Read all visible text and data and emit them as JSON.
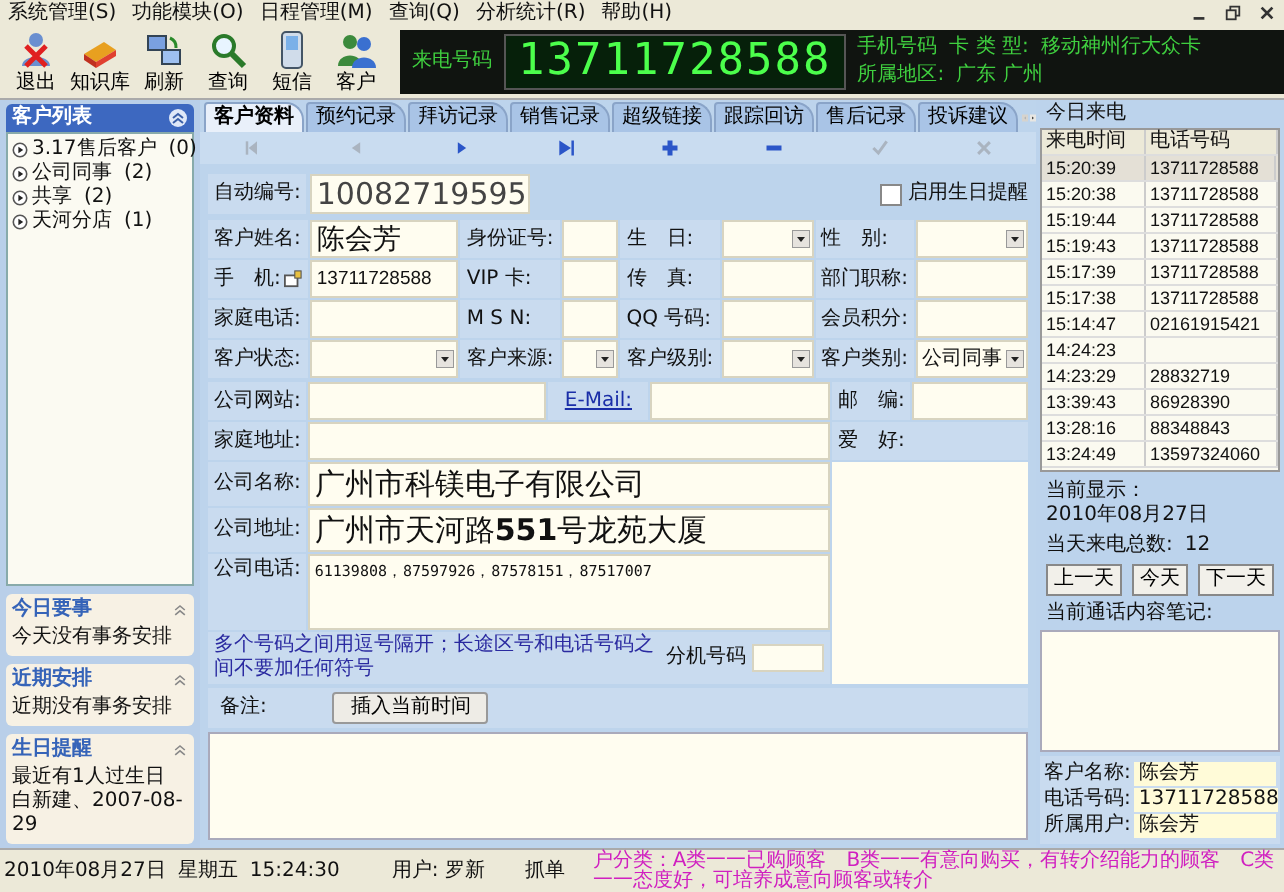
{
  "menu": [
    "系统管理(S)",
    "功能模块(O)",
    "日程管理(M)",
    "查询(Q)",
    "分析统计(R)",
    "帮助(H)"
  ],
  "toolbar": [
    {
      "kind": "exit",
      "label": "退出"
    },
    {
      "kind": "knowledge",
      "label": "知识库"
    },
    {
      "kind": "refresh",
      "label": "刷新"
    },
    {
      "kind": "query",
      "label": "查询"
    },
    {
      "kind": "sms",
      "label": "短信"
    },
    {
      "kind": "customer",
      "label": "客户"
    }
  ],
  "caller_display": {
    "label": "来电号码",
    "number": "13711728588",
    "lines": [
      [
        "手机号码",
        "卡 类 型:",
        "移动神州行大众卡"
      ],
      [
        "所属地区:",
        "广东 广州"
      ]
    ]
  },
  "sidebar": {
    "title": "客户列表",
    "items": [
      {
        "name": "3.17售后客户",
        "count": "(0)"
      },
      {
        "name": "公司同事",
        "count": "(2)"
      },
      {
        "name": "共享",
        "count": "(2)"
      },
      {
        "name": "天河分店",
        "count": "(1)"
      }
    ],
    "panels": [
      {
        "title": "今日要事",
        "lines": [
          "今天没有事务安排"
        ]
      },
      {
        "title": "近期安排",
        "lines": [
          "近期没有事务安排"
        ]
      },
      {
        "title": "生日提醒",
        "lines": [
          "最近有1人过生日",
          "白新建、2007-08-29"
        ]
      }
    ]
  },
  "tabs": [
    {
      "label": "客户资料",
      "selected": true
    },
    {
      "label": "预约记录",
      "selected": false
    },
    {
      "label": "拜访记录",
      "selected": false
    },
    {
      "label": "销售记录",
      "selected": false
    },
    {
      "label": "超级链接",
      "selected": false
    },
    {
      "label": "跟踪回访",
      "selected": false
    },
    {
      "label": "售后记录",
      "selected": false
    },
    {
      "label": "投诉建议",
      "selected": false
    }
  ],
  "nav_buttons": [
    {
      "kind": "first",
      "disabled": true
    },
    {
      "kind": "prev",
      "disabled": true
    },
    {
      "kind": "next",
      "disabled": false
    },
    {
      "kind": "last",
      "disabled": false
    },
    {
      "kind": "add",
      "disabled": false
    },
    {
      "kind": "remove",
      "disabled": false
    },
    {
      "kind": "confirm",
      "disabled": true
    },
    {
      "kind": "cancel",
      "disabled": true
    }
  ],
  "form": {
    "auto_id": {
      "label": "自动编号:",
      "value": "10082719595"
    },
    "birthday_reminder": {
      "label": "启用生日提醒",
      "checked": false
    },
    "grid": [
      [
        {
          "label": "客户姓名:",
          "kind": "large",
          "value": "陈会芳"
        },
        {
          "label": "身份证号:",
          "kind": "text"
        },
        {
          "label": "生　日:",
          "kind": "select"
        },
        {
          "label": "性　别:",
          "kind": "select"
        }
      ],
      [
        {
          "label": "手　机:",
          "kind": "mobile",
          "value": "13711728588"
        },
        {
          "label": "VIP 卡:",
          "kind": "text"
        },
        {
          "label": "传　真:",
          "kind": "text"
        },
        {
          "label": "部门职称:",
          "kind": "text"
        }
      ],
      [
        {
          "label": "家庭电话:",
          "kind": "text"
        },
        {
          "label": "M S N:",
          "kind": "text"
        },
        {
          "label": "QQ 号码:",
          "kind": "text"
        },
        {
          "label": "会员积分:",
          "kind": "text"
        }
      ],
      [
        {
          "label": "客户状态:",
          "kind": "select"
        },
        {
          "label": "客户来源:",
          "kind": "select"
        },
        {
          "label": "客户级别:",
          "kind": "select"
        },
        {
          "label": "客户类别:",
          "kind": "select",
          "value": "公司同事"
        }
      ]
    ],
    "website": {
      "label": "公司网站:"
    },
    "email": {
      "label": "E-Mail:"
    },
    "postcode": {
      "label": "邮　编:"
    },
    "hobby": {
      "label": "爱　好:"
    },
    "home_address": {
      "label": "家庭地址:"
    },
    "company_name": {
      "label": "公司名称:",
      "value": "广州市科镁电子有限公司"
    },
    "company_address": {
      "label": "公司地址:",
      "value": "广州市天河路**551**号龙苑大厦"
    },
    "company_phone": {
      "label": "公司电话:",
      "value": "61139808，87597926，87578151，87517007"
    },
    "hint": "多个号码之间用逗号隔开；长途区号和电话号码之间不要加任何符号",
    "extension": {
      "label": "分机号码"
    },
    "notes": {
      "label": "备注:",
      "button": "插入当前时间"
    }
  },
  "calls": {
    "title": "今日来电",
    "columns": [
      "来电时间",
      "电话号码"
    ],
    "rows": [
      {
        "time": "15:20:39",
        "phone": "13711728588",
        "selected": true
      },
      {
        "time": "15:20:38",
        "phone": "13711728588",
        "selected": false
      },
      {
        "time": "15:19:44",
        "phone": "13711728588",
        "selected": false
      },
      {
        "time": "15:19:43",
        "phone": "13711728588",
        "selected": false
      },
      {
        "time": "15:17:39",
        "phone": "13711728588",
        "selected": false
      },
      {
        "time": "15:17:38",
        "phone": "13711728588",
        "selected": false
      },
      {
        "time": "15:14:47",
        "phone": "02161915421",
        "selected": false
      },
      {
        "time": "14:24:23",
        "selected": false
      },
      {
        "time": "14:23:29",
        "phone": "28832719",
        "selected": false
      },
      {
        "time": "13:39:43",
        "phone": "86928390",
        "selected": false
      },
      {
        "time": "13:28:16",
        "phone": "88348843",
        "selected": false
      },
      {
        "time": "13:24:49",
        "phone": "13597324060",
        "selected": false
      }
    ],
    "current_display": {
      "label": "当前显示：",
      "value": "2010年08月27日"
    },
    "total": {
      "label": "当天来电总数:",
      "value": "12"
    },
    "day_buttons": [
      "上一天",
      "今天",
      "下一天"
    ],
    "notes_label": "当前通话内容笔记:",
    "caller_fields": [
      {
        "label": "客户名称:",
        "value": "陈会芳"
      },
      {
        "label": "电话号码:",
        "value": "13711728588"
      },
      {
        "label": "所属用户:",
        "value": "陈会芳"
      }
    ]
  },
  "status_bar": {
    "date": "2010年08月27日",
    "weekday": "星期五",
    "time": "15:24:30",
    "user": "用户: 罗新",
    "mode": "抓单",
    "legend": "户分类：A类一一已购顾客　B类一一有意向购买，有转介绍能力的顾客　C类一一态度好，可培养成意向顾客或转介"
  }
}
